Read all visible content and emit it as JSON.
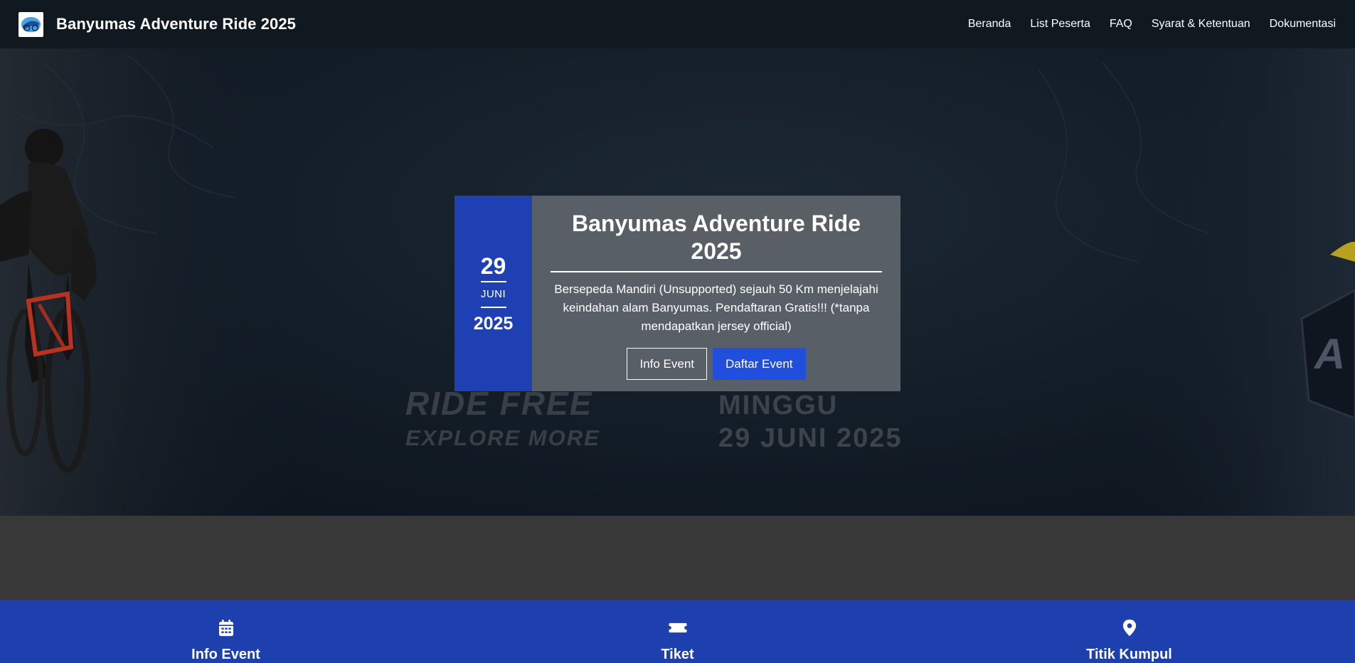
{
  "navbar": {
    "brand_title": "Banyumas Adventure Ride 2025",
    "links": [
      "Beranda",
      "List Peserta",
      "FAQ",
      "Syarat & Ketentuan",
      "Dokumentasi"
    ]
  },
  "hero": {
    "banner_text": {
      "line1": "RIDE FREE",
      "line2": "EXPLORE MORE",
      "day": "MINGGU",
      "date": "29 JUNI 2025"
    }
  },
  "event_card": {
    "day": "29",
    "month": "JUNI",
    "year": "2025",
    "title": "Banyumas Adventure Ride 2025",
    "description": "Bersepeda Mandiri (Unsupported) sejauh 50 Km menjelajahi keindahan alam Banyumas. Pendaftaran Gratis!!! (*tanpa mendapatkan jersey official)",
    "btn_info": "Info Event",
    "btn_daftar": "Daftar Event"
  },
  "features": [
    {
      "label": "Info Event",
      "icon": "calendar-icon"
    },
    {
      "label": "Tiket",
      "icon": "ticket-icon"
    },
    {
      "label": "Titik Kumpul",
      "icon": "map-pin-icon"
    }
  ],
  "colors": {
    "navbar_bg": "#101820",
    "accent_blue": "#1f40b3",
    "primary_button": "#1f4fdc",
    "feature_bar": "#1e3fae",
    "card_gray": "#5f646a"
  }
}
